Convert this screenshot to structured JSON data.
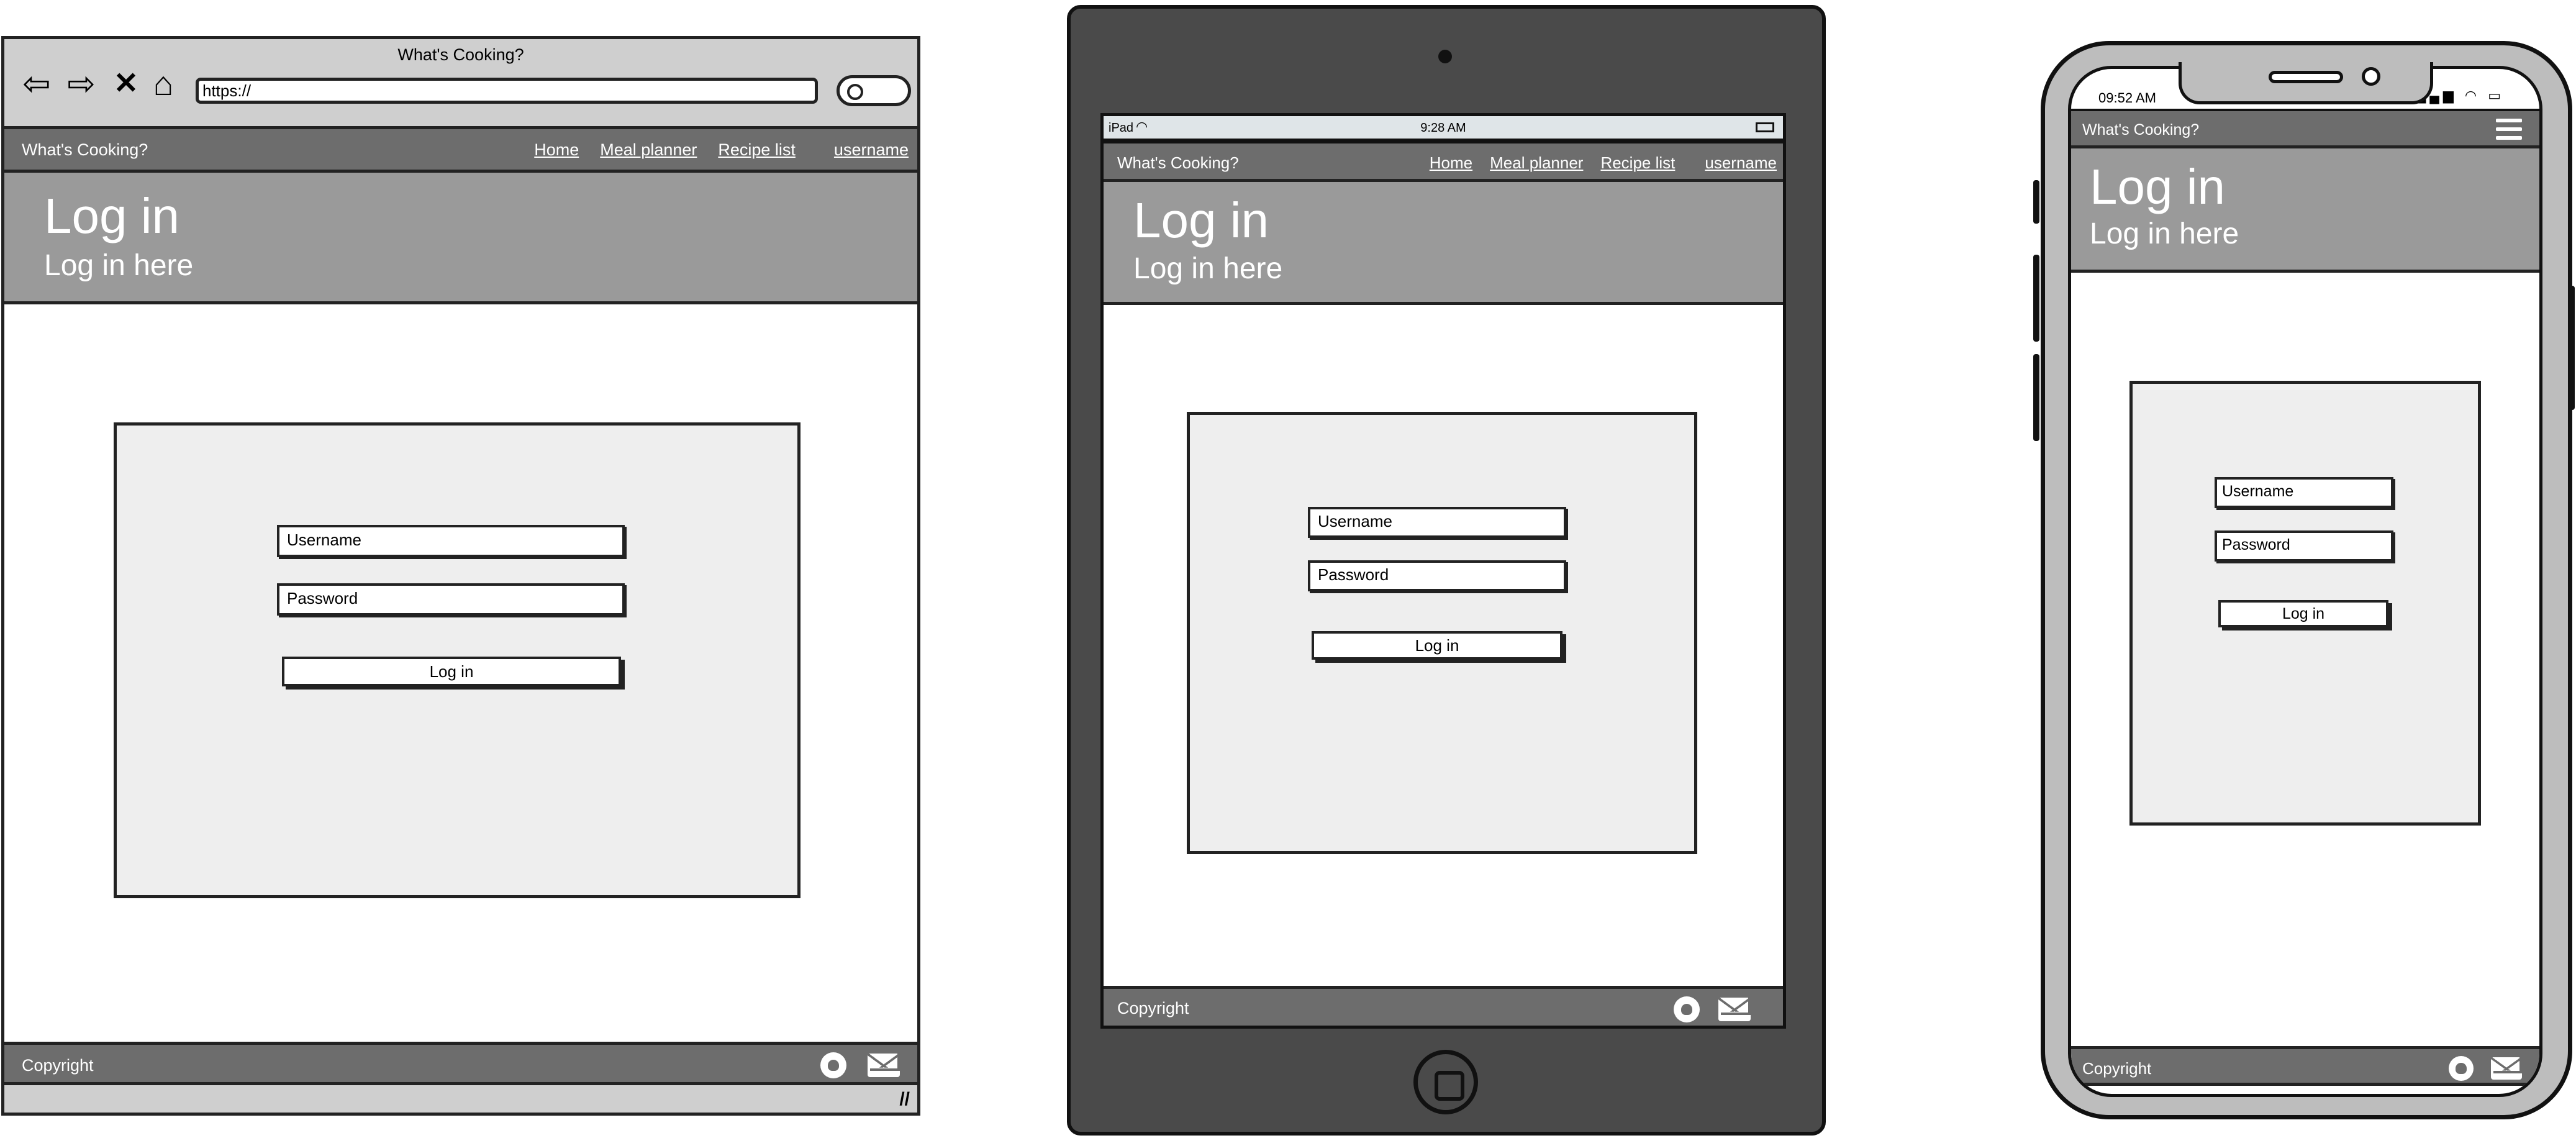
{
  "app": {
    "title": "What's Cooking?",
    "brand": "What's Cooking?"
  },
  "browser": {
    "url": "https://"
  },
  "nav": {
    "home": "Home",
    "meal_planner": "Meal planner",
    "recipe_list": "Recipe list",
    "username": "username"
  },
  "hero": {
    "title": "Log in",
    "subtitle": "Log in here"
  },
  "form": {
    "username_placeholder": "Username",
    "password_placeholder": "Password",
    "login_button": "Log in"
  },
  "footer": {
    "copyright": "Copyright"
  },
  "tablet": {
    "carrier": "iPad",
    "time": "9:28 AM"
  },
  "phone": {
    "time": "09:52 AM"
  },
  "icons": {
    "back": "back-arrow-icon",
    "forward": "forward-arrow-icon",
    "stop": "close-icon",
    "home": "home-icon",
    "search": "search-icon",
    "github": "github-icon",
    "mail": "mail-icon",
    "menu": "hamburger-menu-icon"
  },
  "colors": {
    "nav_bg": "#6d6d6d",
    "hero_bg": "#9a9a9a",
    "card_bg": "#eeeeee",
    "device_dark": "#4a4a4a",
    "device_light": "#bdbdbd"
  }
}
